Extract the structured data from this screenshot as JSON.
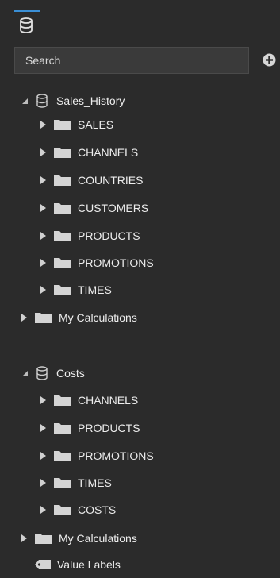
{
  "search": {
    "placeholder": "Search"
  },
  "sources": [
    {
      "name": "Sales_History",
      "folders": [
        "SALES",
        "CHANNELS",
        "COUNTRIES",
        "CUSTOMERS",
        "PRODUCTS",
        "PROMOTIONS",
        "TIMES"
      ],
      "calculations_label": "My Calculations"
    },
    {
      "name": "Costs",
      "folders": [
        "CHANNELS",
        "PRODUCTS",
        "PROMOTIONS",
        "TIMES",
        "COSTS"
      ],
      "calculations_label": "My Calculations",
      "value_labels_label": "Value Labels"
    }
  ],
  "icons": {
    "tab": "database-icon",
    "add": "plus-circle-icon",
    "expanded": "caret-down-icon",
    "collapsed": "caret-right-icon",
    "folder": "folder-icon",
    "source": "database-icon",
    "value_labels": "tag-icon"
  },
  "colors": {
    "accent": "#3a8fd6",
    "background": "#2b2b2b",
    "icon": "#d0d0d0"
  }
}
